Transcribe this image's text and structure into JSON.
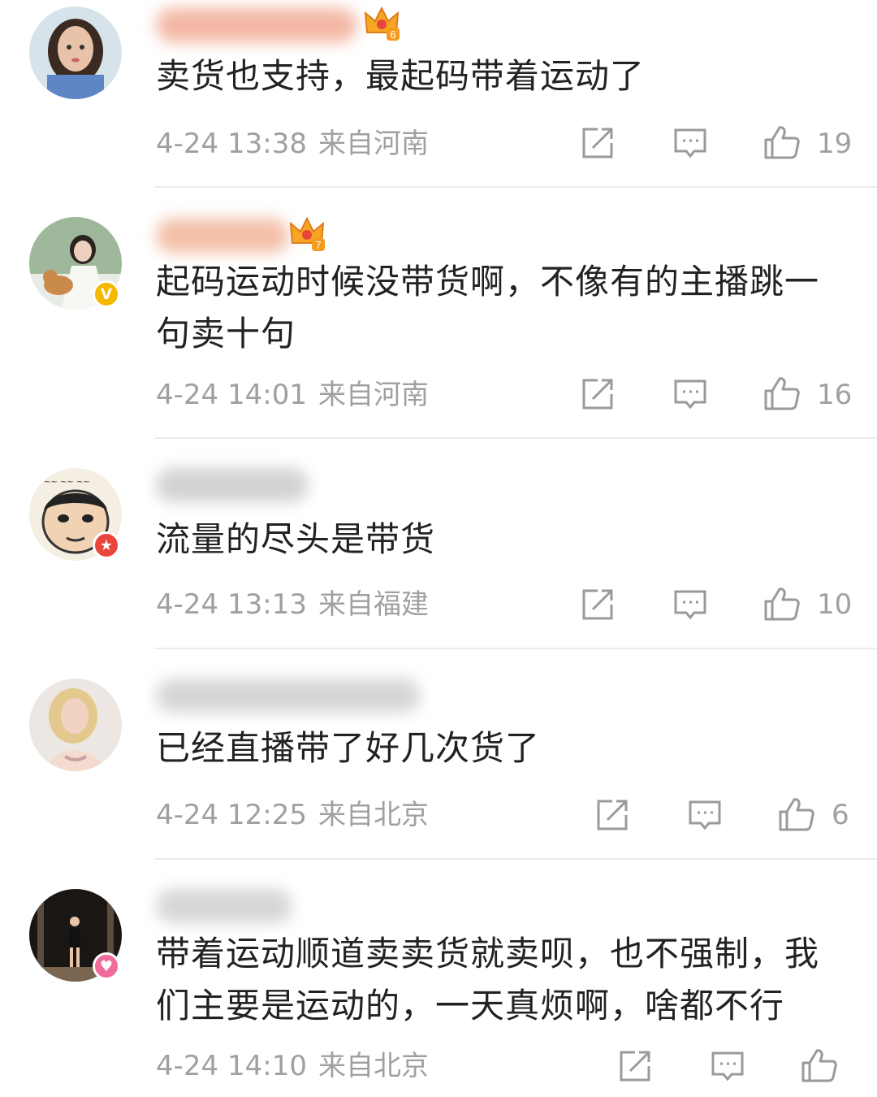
{
  "comments": [
    {
      "text": "卖货也支持，最起码带着运动了",
      "time": "4-24 13:38",
      "location": "来自河南",
      "likes": "19",
      "crown_level": "6",
      "badge": ""
    },
    {
      "text": "起码运动时候没带货啊，不像有的主播跳一句卖十句",
      "time": "4-24 14:01",
      "location": "来自河南",
      "likes": "16",
      "crown_level": "7",
      "badge": "V"
    },
    {
      "text": "流量的尽头是带货",
      "time": "4-24 13:13",
      "location": "来自福建",
      "likes": "10",
      "crown_level": "",
      "badge": "★"
    },
    {
      "text": "已经直播带了好几次货了",
      "time": "4-24 12:25",
      "location": "来自北京",
      "likes": "6",
      "crown_level": "",
      "badge": ""
    },
    {
      "text": "带着运动顺道卖卖货就卖呗，也不强制，我们主要是运动的，一天真烦啊，啥都不行",
      "time": "4-24 14:10",
      "location": "来自北京",
      "likes": "",
      "crown_level": "",
      "badge": "♥"
    }
  ],
  "icons": {
    "share": "share-icon",
    "comment": "comment-icon",
    "like": "thumbs-up-icon",
    "crown": "crown-icon"
  },
  "colors": {
    "text": "#222222",
    "meta": "#a0a0a0",
    "divider": "#ececec",
    "crown": "#f5a623",
    "verified_badge": "#f5b800",
    "red_badge": "#e8453c",
    "pink_badge": "#f06a9b"
  }
}
